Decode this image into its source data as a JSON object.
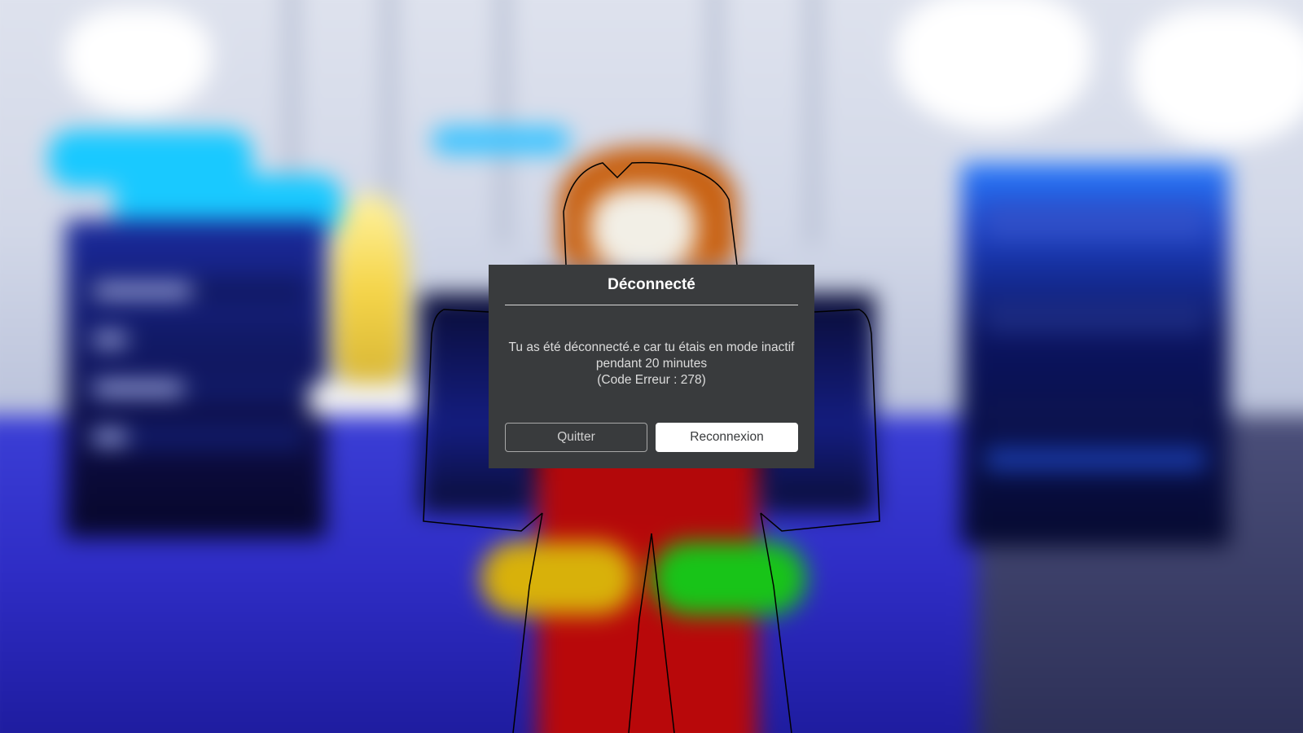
{
  "dialog": {
    "title": "Déconnecté",
    "message_lines": [
      "Tu as été déconnecté.e car tu étais en mode inactif",
      "pendant 20 minutes",
      "(Code Erreur : 278)"
    ],
    "buttons": {
      "quit": "Quitter",
      "reconnect": "Reconnexion"
    }
  },
  "colors": {
    "dialog_background": "#393b3d",
    "primary_button": "#ffffff",
    "floor": "#2f2dc6",
    "neon": "#19c9ff"
  }
}
